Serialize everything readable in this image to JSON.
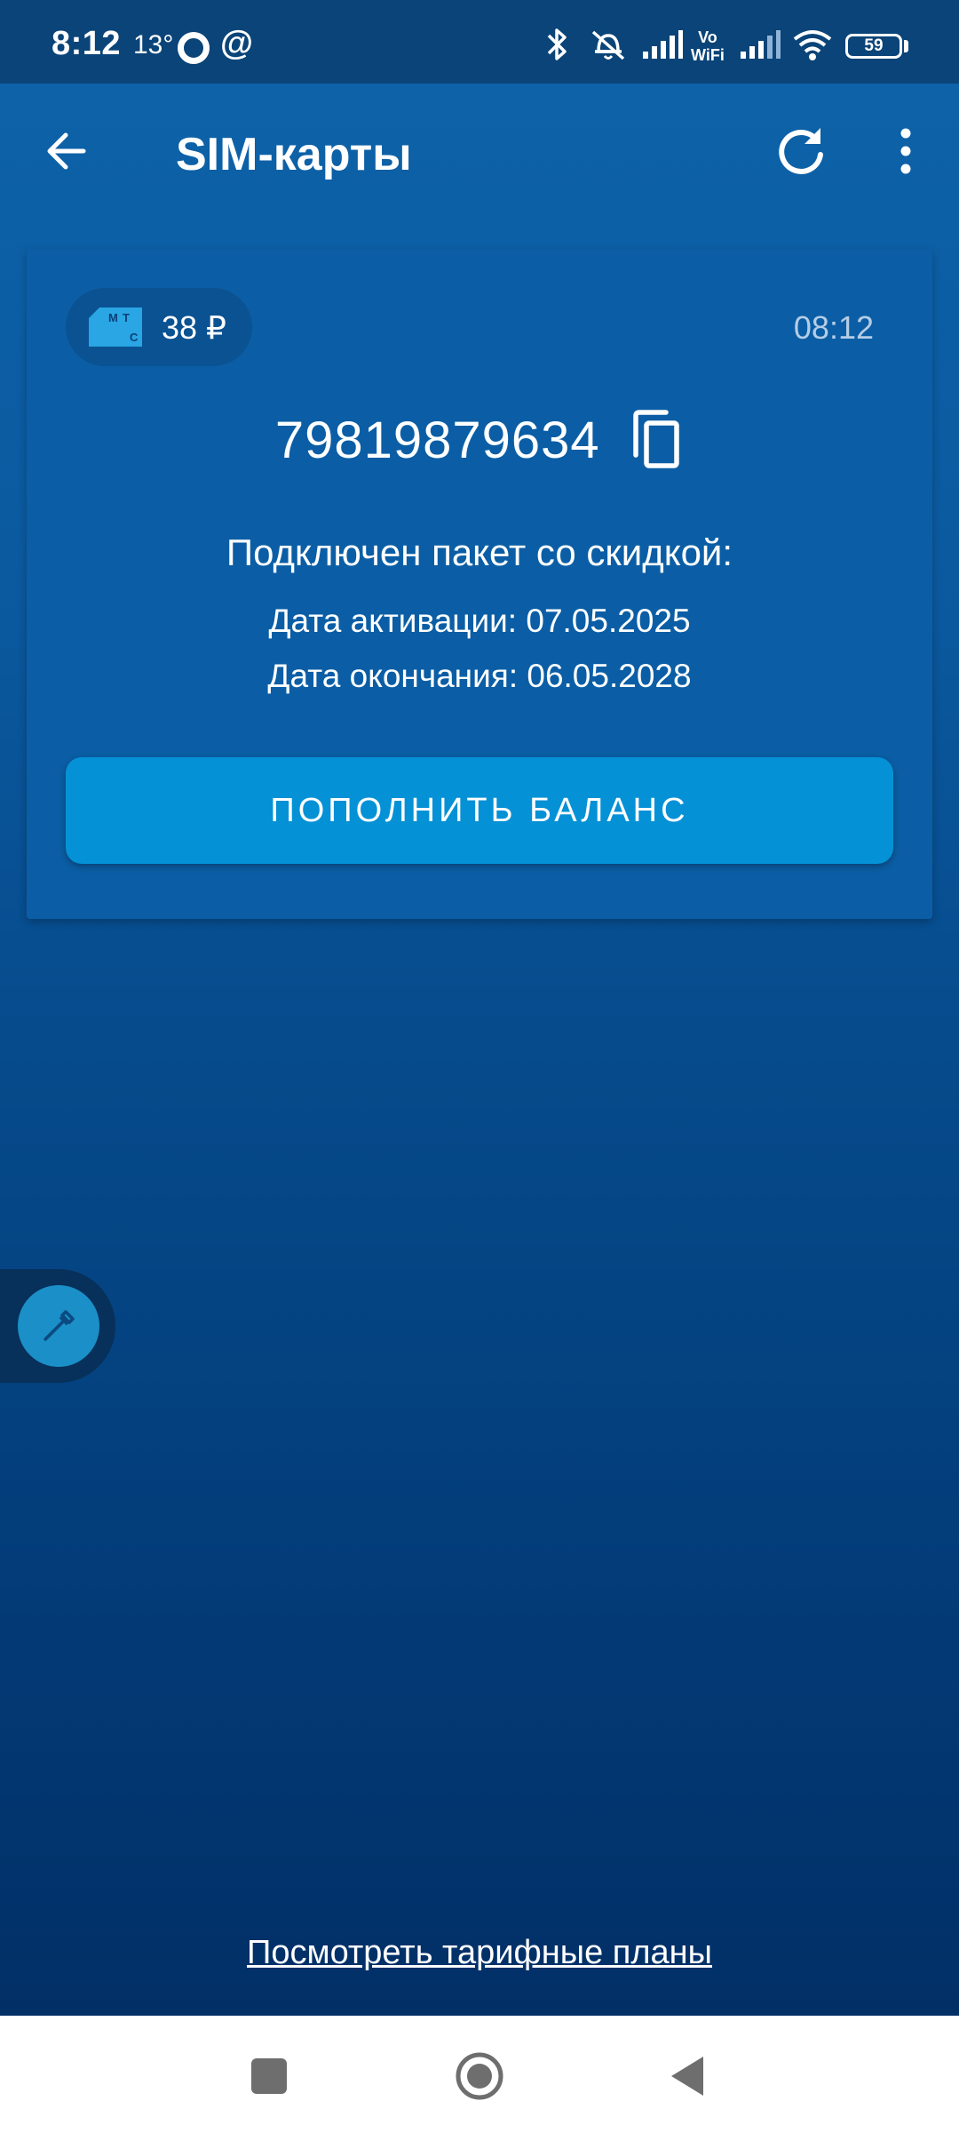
{
  "status_bar": {
    "time": "8:12",
    "temperature": "13°",
    "vowifi_top": "Vo",
    "vowifi_bottom": "WiFi",
    "battery": "59"
  },
  "app_bar": {
    "title": "SIM-карты",
    "back_icon": "arrow-left-icon",
    "refresh_icon": "refresh-icon",
    "menu_icon": "more-vert-icon"
  },
  "sim_card": {
    "operator_logo_text": "МТС",
    "balance": "38 ₽",
    "time": "08:12",
    "phone_number": "79819879634",
    "package_title": "Подключен пакет со скидкой:",
    "activation_date": "Дата активации: 07.05.2025",
    "end_date": "Дата окончания: 06.05.2028",
    "topup_label": "ПОПОЛНИТЬ БАЛАНС"
  },
  "side_tab": {
    "icon": "eyedropper-icon"
  },
  "footer": {
    "tariff_link": "Посмотреть тарифные планы"
  },
  "colors": {
    "accent": "#0591d6",
    "card_bg": "#0b5ea5",
    "app_bg_top": "#0d62a8",
    "app_bg_bottom": "#022f66"
  }
}
